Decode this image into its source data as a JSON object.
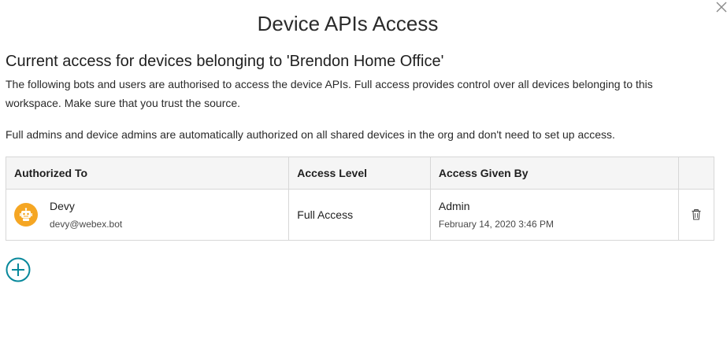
{
  "dialog": {
    "title": "Device APIs Access",
    "close_icon": "close-icon"
  },
  "section": {
    "heading": "Current access for devices belonging to 'Brendon Home Office'",
    "description": "The following bots and users are authorised to access the device APIs. Full access provides control over all devices belonging to this workspace. Make sure that you trust the source.",
    "admin_note": "Full admins and device admins are automatically authorized on all shared devices in the org and don't need to set up access."
  },
  "table": {
    "headers": {
      "authorized_to": "Authorized To",
      "access_level": "Access Level",
      "access_given_by": "Access Given By",
      "actions": ""
    },
    "rows": [
      {
        "name": "Devy",
        "email": "devy@webex.bot",
        "access_level": "Full Access",
        "given_by": "Admin",
        "given_date": "February 14, 2020 3:46 PM",
        "avatar_icon": "bot-icon",
        "delete_icon": "trash-icon"
      }
    ]
  },
  "add_button": {
    "icon": "add-circle-icon"
  },
  "colors": {
    "avatar_bg": "#f5a623",
    "accent": "#07889b",
    "header_bg": "#f5f5f5",
    "border": "#d7d7d7"
  }
}
